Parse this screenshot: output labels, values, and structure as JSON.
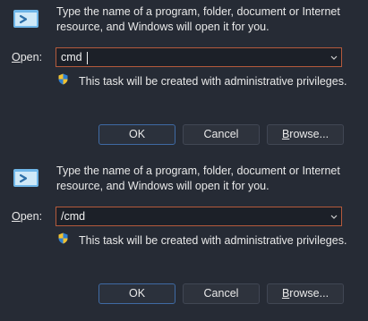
{
  "dialogs": [
    {
      "description": "Type the name of a program, folder, document or Internet resource, and Windows will open it for you.",
      "open_label": {
        "mnemonic": "O",
        "rest": "pen:"
      },
      "open_value": "cmd",
      "admin_note": "This task will be created with administrative privileges.",
      "ok": "OK",
      "cancel": "Cancel",
      "browse": {
        "mnemonic": "B",
        "rest": "rowse..."
      }
    },
    {
      "description": "Type the name of a program, folder, document or Internet resource, and Windows will open it for you.",
      "open_label": {
        "mnemonic": "O",
        "rest": "pen:"
      },
      "open_value": "/cmd",
      "admin_note": "This task will be created with administrative privileges.",
      "ok": "OK",
      "cancel": "Cancel",
      "browse": {
        "mnemonic": "B",
        "rest": "rowse..."
      }
    }
  ],
  "icons": {
    "run": "run-dialog-icon",
    "shield": "uac-shield-icon",
    "dropdown": "chevron-down-icon"
  },
  "colors": {
    "background": "#262b35",
    "focus_border": "#b45a3c",
    "ok_border": "#3f6aa4"
  }
}
